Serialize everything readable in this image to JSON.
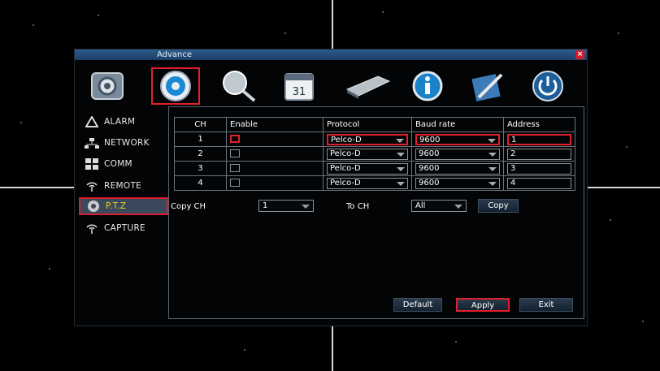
{
  "window": {
    "title": "Advance",
    "close_glyph": "×"
  },
  "toolbar": [
    {
      "icon": "system-gear-icon"
    },
    {
      "icon": "settings-gear-icon",
      "selected": true
    },
    {
      "icon": "search-magnifier-icon"
    },
    {
      "icon": "calendar-icon"
    },
    {
      "icon": "hard-disk-icon"
    },
    {
      "icon": "info-icon"
    },
    {
      "icon": "tools-icon"
    },
    {
      "icon": "power-icon"
    }
  ],
  "sidebar": {
    "items": [
      {
        "label": "ALARM",
        "icon": "alarm-icon"
      },
      {
        "label": "NETWORK",
        "icon": "network-icon"
      },
      {
        "label": "COMM",
        "icon": "comm-icon"
      },
      {
        "label": "REMOTE",
        "icon": "remote-icon"
      },
      {
        "label": "P.T.Z",
        "icon": "ptz-camera-icon",
        "active": true
      },
      {
        "label": "CAPTURE",
        "icon": "capture-icon"
      }
    ]
  },
  "table": {
    "headers": [
      "CH",
      "Enable",
      "Protocol",
      "Baud rate",
      "Address"
    ],
    "rows": [
      {
        "ch": "1",
        "protocol": "Pelco-D",
        "baud": "9600",
        "address": "1"
      },
      {
        "ch": "2",
        "protocol": "Pelco-D",
        "baud": "9600",
        "address": "2"
      },
      {
        "ch": "3",
        "protocol": "Pelco-D",
        "baud": "9600",
        "address": "3"
      },
      {
        "ch": "4",
        "protocol": "Pelco-D",
        "baud": "9600",
        "address": "4"
      }
    ]
  },
  "copy": {
    "copy_ch_label": "Copy CH",
    "copy_ch_value": "1",
    "to_ch_label": "To CH",
    "to_ch_value": "All",
    "copy_button": "Copy"
  },
  "buttons": {
    "default": "Default",
    "apply": "Apply",
    "exit": "Exit"
  },
  "colors": {
    "highlight": "#e0202c",
    "titlebar": "#2d5c8c",
    "active_label": "#f0d020"
  }
}
